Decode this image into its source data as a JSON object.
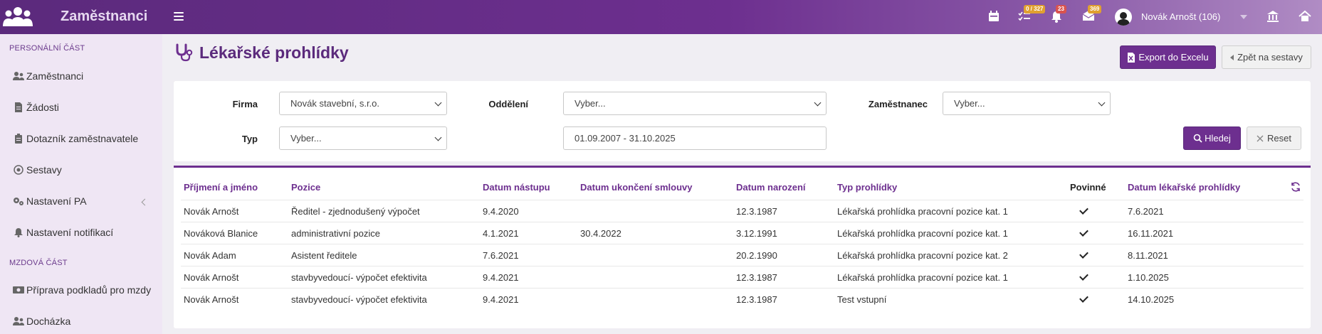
{
  "topbar": {
    "brand": "Zaměstnanci",
    "badges": {
      "tasks": "0 / 327",
      "notifications": "23",
      "messages": "369"
    },
    "user": "Novák Arnošt (106)"
  },
  "sidebar": {
    "section1": "PERSONÁLNÍ ČÁST",
    "items1": [
      "Zaměstnanci",
      "Žádosti",
      "Dotazník zaměstnavatele",
      "Sestavy",
      "Nastavení PA",
      "Nastavení notifikací"
    ],
    "section2": "MZDOVÁ ČÁST",
    "items2": [
      "Příprava podkladů pro mzdy",
      "Docházka"
    ]
  },
  "page": {
    "title": "Lékařské prohlídky",
    "export_label": "Export do Excelu",
    "back_label": "Zpět na sestavy"
  },
  "filters": {
    "firma_label": "Firma",
    "firma_value": "Novák stavební, s.r.o.",
    "oddeleni_label": "Oddělení",
    "oddeleni_value": "Vyber...",
    "zamestnanec_label": "Zaměstnanec",
    "zamestnanec_value": "Vyber...",
    "typ_label": "Typ",
    "typ_value": "Vyber...",
    "date_range": "01.09.2007 - 31.10.2025",
    "search_label": "Hledej",
    "reset_label": "Reset"
  },
  "table": {
    "headers": [
      "Příjmení a jméno",
      "Pozice",
      "Datum nástupu",
      "Datum ukončení smlouvy",
      "Datum narození",
      "Typ prohlídky",
      "Povinné",
      "Datum lékařské prohlídky"
    ],
    "rows": [
      [
        "Novák Arnošt",
        "Ředitel - zjednodušený výpočet",
        "9.4.2020",
        "",
        "12.3.1987",
        "Lékařská prohlídka pracovní pozice kat. 1",
        true,
        "7.6.2021"
      ],
      [
        "Nováková Blanice",
        "administrativní pozice",
        "4.1.2021",
        "30.4.2022",
        "3.12.1991",
        "Lékařská prohlídka pracovní pozice kat. 1",
        true,
        "16.11.2021"
      ],
      [
        "Novák Adam",
        "Asistent ředitele",
        "7.6.2021",
        "",
        "20.2.1990",
        "Lékařská prohlídka pracovní pozice kat. 2",
        true,
        "8.11.2021"
      ],
      [
        "Novák Arnošt",
        "stavbyvedoucí- výpočet efektivita",
        "9.4.2021",
        "",
        "12.3.1987",
        "Lékařská prohlídka pracovní pozice kat. 1",
        true,
        "1.10.2025"
      ],
      [
        "Novák Arnošt",
        "stavbyvedoucí- výpočet efektivita",
        "9.4.2021",
        "",
        "12.3.1987",
        "Test vstupní",
        true,
        "14.10.2025"
      ]
    ]
  },
  "colors": {
    "brand": "#6d2f8f",
    "sidebar": "#efe6f4",
    "badge_orange": "#e0a030",
    "badge_red": "#d9534f"
  },
  "icons": [
    "users-logo-icon",
    "menu-icon",
    "calendar-icon",
    "tasks-icon",
    "bell-icon",
    "messages-icon",
    "avatar-icon",
    "bank-icon",
    "home-icon",
    "stethoscope-icon",
    "excel-icon",
    "back-icon",
    "search-icon",
    "close-icon",
    "refresh-icon",
    "check-icon"
  ]
}
